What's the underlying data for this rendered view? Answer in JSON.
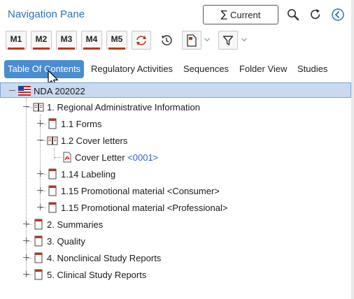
{
  "header": {
    "title": "Navigation Pane",
    "current_button": {
      "symbol": "∑",
      "label": "Current"
    },
    "icons": [
      "search-icon",
      "refresh-icon",
      "collapse-pane-icon"
    ]
  },
  "toolbar": {
    "module_buttons": [
      "M1",
      "M2",
      "M3",
      "M4",
      "M5"
    ],
    "icons": [
      "sync-icon",
      "history-icon",
      "document-icon",
      "filter-icon"
    ]
  },
  "tabs": [
    {
      "label": "Table Of Contents",
      "active": true
    },
    {
      "label": "Regulatory Activities",
      "active": false
    },
    {
      "label": "Sequences",
      "active": false
    },
    {
      "label": "Folder View",
      "active": false
    },
    {
      "label": "Studies",
      "active": false
    }
  ],
  "tree": {
    "root": {
      "label": "NDA 202022",
      "icon": "us-flag-icon"
    },
    "items": [
      {
        "label": "1. Regional Administrative Information"
      },
      {
        "label": "1.1 Forms"
      },
      {
        "label": "1.2 Cover letters"
      },
      {
        "label": "Cover Letter",
        "suffix": "<0001>"
      },
      {
        "label": "1.14 Labeling"
      },
      {
        "label": "1.15 Promotional material <Consumer>"
      },
      {
        "label": "1.15 Promotional material <Professional>"
      },
      {
        "label": "2. Summaries"
      },
      {
        "label": "3. Quality"
      },
      {
        "label": "4. Nonclinical Study Reports"
      },
      {
        "label": "5. Clinical Study Reports"
      }
    ]
  },
  "colors": {
    "title": "#2b72b8",
    "active_tab": "#4a8cd0",
    "module_underline": "#b5391e",
    "selected_row": "#c9daf0",
    "sequence_number": "#2f5fdd"
  }
}
